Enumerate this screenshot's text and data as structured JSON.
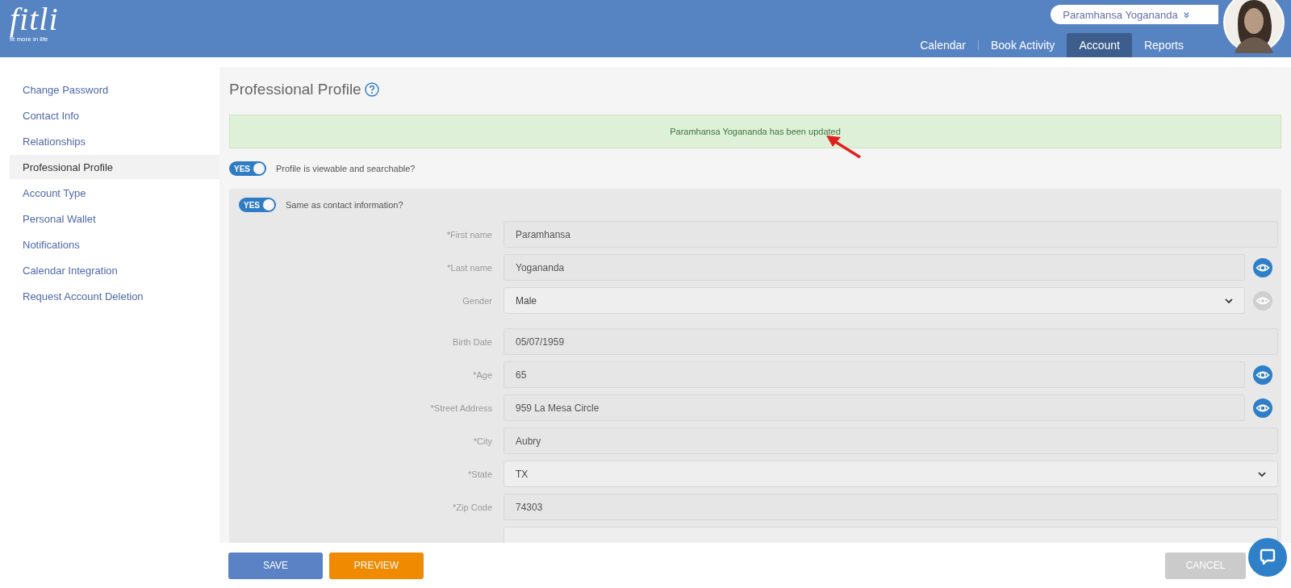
{
  "logo": {
    "name": "fitli",
    "tagline": "fit more in life"
  },
  "user_menu": {
    "name": "Paramhansa Yogananda"
  },
  "nav": [
    {
      "label": "Calendar",
      "selected": false
    },
    {
      "label": "Book Activity",
      "selected": false
    },
    {
      "label": "Account",
      "selected": true
    },
    {
      "label": "Reports",
      "selected": false
    }
  ],
  "sidebar": {
    "items": [
      {
        "label": "Change Password",
        "selected": false
      },
      {
        "label": "Contact Info",
        "selected": false
      },
      {
        "label": "Relationships",
        "selected": false
      },
      {
        "label": "Professional Profile",
        "selected": true
      },
      {
        "label": "Account Type",
        "selected": false
      },
      {
        "label": "Personal Wallet",
        "selected": false
      },
      {
        "label": "Notifications",
        "selected": false
      },
      {
        "label": "Calendar Integration",
        "selected": false
      },
      {
        "label": "Request Account Deletion",
        "selected": false
      }
    ]
  },
  "page_title": "Professional Profile",
  "alert": {
    "text": "Paramhansa Yogananda has been updated"
  },
  "profile_toggle": {
    "on": true,
    "state_text": "YES",
    "label": "Profile is viewable and searchable?"
  },
  "contact_toggle": {
    "on": true,
    "state_text": "YES",
    "label": "Same as contact information?"
  },
  "fields": [
    {
      "label": "*First name",
      "value": "Paramhansa",
      "kind": "text"
    },
    {
      "label": "*Last name",
      "value": "Yogananda",
      "kind": "text",
      "public": true
    },
    {
      "label": "Gender",
      "value": "Male",
      "kind": "select",
      "public": false
    },
    {
      "label": "Birth Date",
      "value": "05/07/1959",
      "kind": "text"
    },
    {
      "label": "*Age",
      "value": "65",
      "kind": "text",
      "public": true
    },
    {
      "label": "*Street Address",
      "value": "959 La Mesa Circle",
      "kind": "text",
      "public": true
    },
    {
      "label": "*City",
      "value": "Aubry",
      "kind": "text"
    },
    {
      "label": "*State",
      "value": "TX",
      "kind": "select"
    },
    {
      "label": "*Zip Code",
      "value": "74303",
      "kind": "text"
    }
  ],
  "buttons": [
    {
      "label": "SAVE",
      "kind": "primary"
    },
    {
      "label": "PREVIEW",
      "kind": "secondary"
    },
    {
      "label": "CANCEL",
      "kind": "disabled"
    }
  ]
}
